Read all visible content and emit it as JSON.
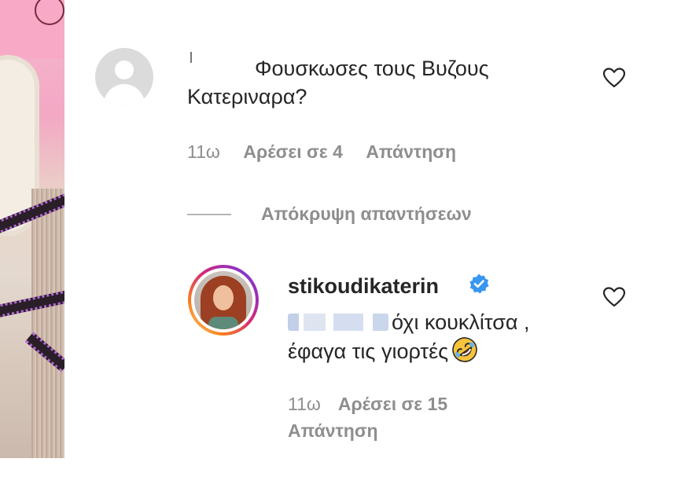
{
  "comment1": {
    "username": "",
    "text_line1": "Φουσκωσες τους Βυζους",
    "text_line2": "Κατεριναρα?",
    "time": "11ω",
    "likes": "Αρέσει σε 4",
    "reply": "Απάντηση",
    "hide_replies": "Απόκρυψη απαντήσεων"
  },
  "comment2": {
    "username": "stikoudikaterin",
    "verified": true,
    "text_line1": "όχι κουκλίτσα ,",
    "text_line2": "έφαγα τις γιορτές",
    "emoji": "rolling-on-floor-laughing",
    "time": "11ω",
    "likes": "Αρέσει σε 15",
    "reply": "Απάντηση"
  },
  "icons": {
    "like": "heart-outline-icon",
    "verified": "verified-badge-icon"
  },
  "colors": {
    "text": "#262626",
    "meta": "#8e8e8e",
    "verified": "#3897f0",
    "avatar_placeholder": "#dbdbdb"
  }
}
